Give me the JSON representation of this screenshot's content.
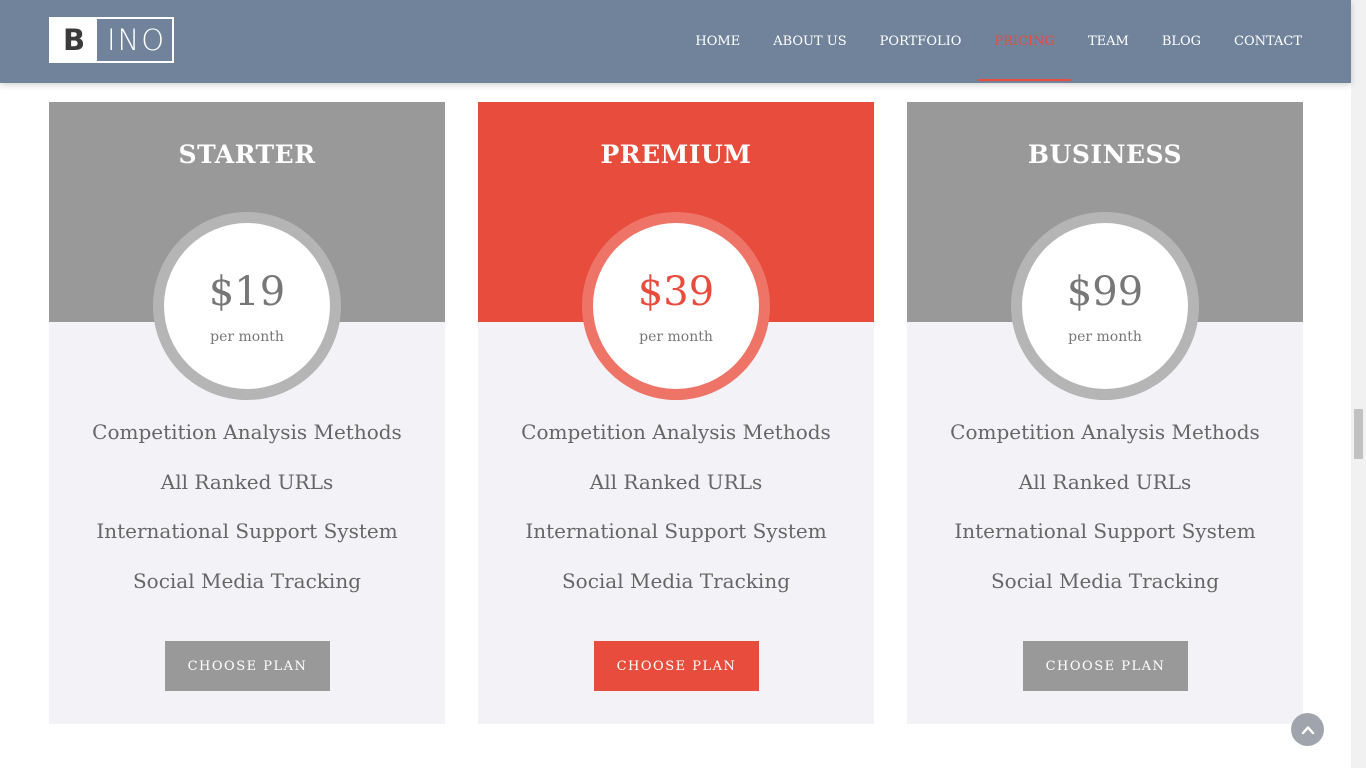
{
  "brand": {
    "logo_letter": "B",
    "logo_rest": "INO"
  },
  "nav": {
    "items": [
      {
        "label": "HOME",
        "active": false
      },
      {
        "label": "ABOUT US",
        "active": false
      },
      {
        "label": "PORTFOLIO",
        "active": false
      },
      {
        "label": "PRICING",
        "active": true
      },
      {
        "label": "TEAM",
        "active": false
      },
      {
        "label": "BLOG",
        "active": false
      },
      {
        "label": "CONTACT",
        "active": false
      }
    ]
  },
  "plans": [
    {
      "name": "STARTER",
      "price": "$19",
      "period": "per month",
      "features": [
        "Competition Analysis Methods",
        "All Ranked URLs",
        "International Support System",
        "Social Media Tracking"
      ],
      "button": "CHOOSE PLAN",
      "featured": false
    },
    {
      "name": "PREMIUM",
      "price": "$39",
      "period": "per month",
      "features": [
        "Competition Analysis Methods",
        "All Ranked URLs",
        "International Support System",
        "Social Media Tracking"
      ],
      "button": "CHOOSE PLAN",
      "featured": true
    },
    {
      "name": "BUSINESS",
      "price": "$99",
      "period": "per month",
      "features": [
        "Competition Analysis Methods",
        "All Ranked URLs",
        "International Support System",
        "Social Media Tracking"
      ],
      "button": "CHOOSE PLAN",
      "featured": false
    }
  ],
  "colors": {
    "header_bg": "#71829b",
    "accent": "#e74c3c",
    "card_head_default": "#999999",
    "ring_default": "#b5b5b5",
    "ring_featured": "#ee7467",
    "price_default": "#777777",
    "button_default": "#999999"
  },
  "icons": {
    "back_to_top": "chevron-up-icon"
  }
}
